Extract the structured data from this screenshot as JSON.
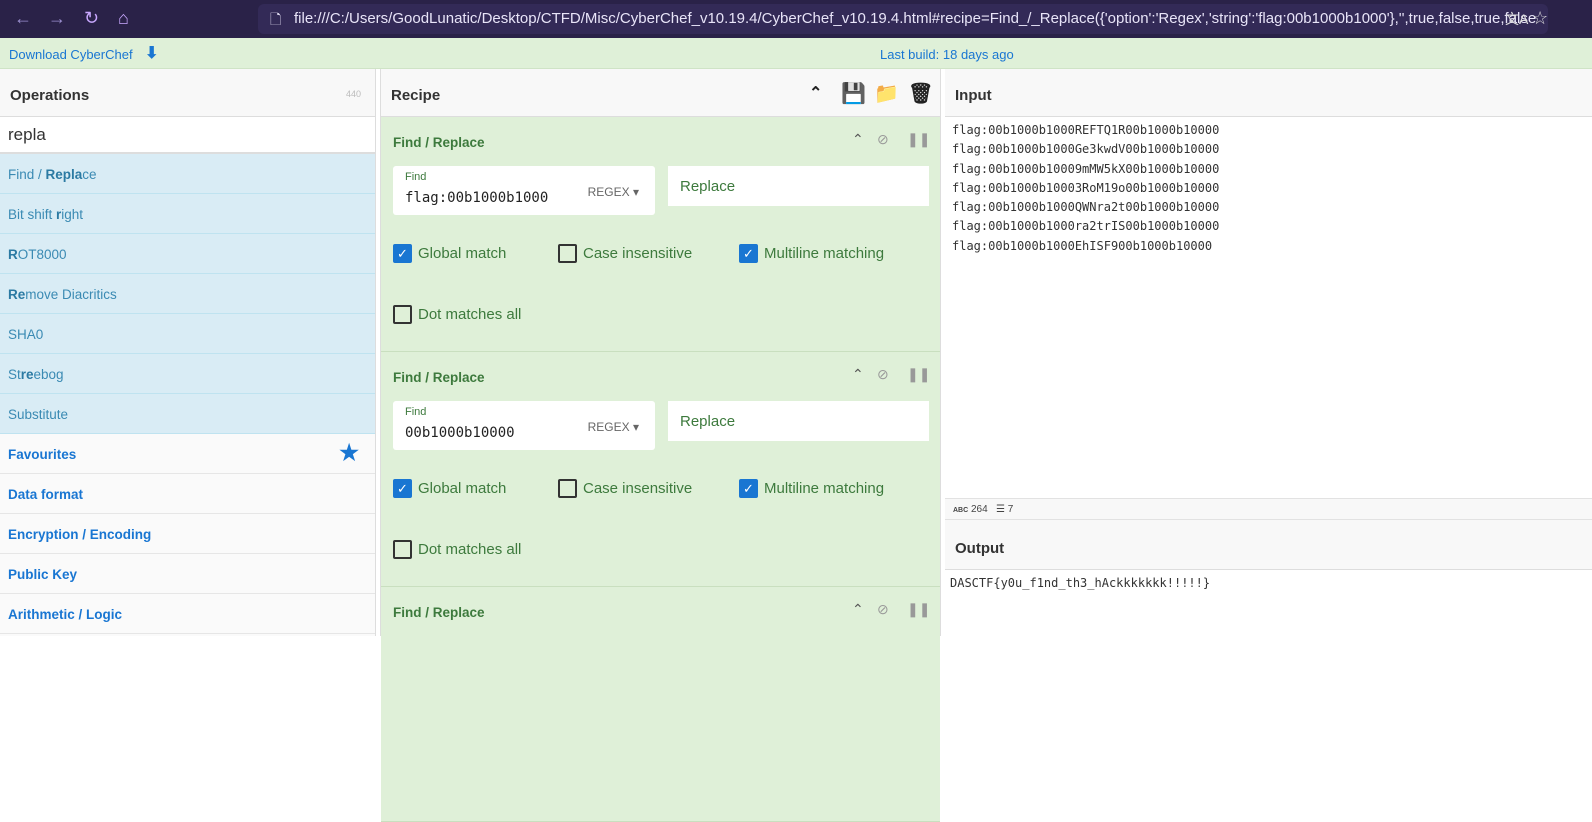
{
  "browser": {
    "url": "file:///C:/Users/GoodLunatic/Desktop/CTFD/Misc/CyberChef_v10.19.4/CyberChef_v10.19.4.html#recipe=Find_/_Replace({'option':'Regex','string':'flag:00b1000b1000'},'',true,false,true,false"
  },
  "banner": {
    "download": "Download CyberChef",
    "build": "Last build: 18 days ago"
  },
  "operations": {
    "title": "Operations",
    "count": "440",
    "search": "repla",
    "results": [
      {
        "pre": "Find / ",
        "bold": "Repla",
        "post": "ce"
      },
      {
        "pre": "Bit shift ",
        "bold": "r",
        "post": "ight"
      },
      {
        "pre": "",
        "bold": "R",
        "post": "OT8000"
      },
      {
        "pre": "",
        "bold": "Re",
        "post": "move Diacritics"
      },
      {
        "pre": "SHA0",
        "bold": "",
        "post": ""
      },
      {
        "pre": "St",
        "bold": "re",
        "post": "ebog"
      },
      {
        "pre": "Substitute",
        "bold": "",
        "post": ""
      }
    ],
    "categories": [
      "Favourites",
      "Data format",
      "Encryption / Encoding",
      "Public Key",
      "Arithmetic / Logic"
    ]
  },
  "recipe": {
    "title": "Recipe",
    "steps": [
      {
        "name": "Find / Replace",
        "find_label": "Find",
        "find": "flag:00b1000b1000",
        "mode": "REGEX",
        "replace_placeholder": "Replace",
        "global": "Global match",
        "case": "Case insensitive",
        "multiline": "Multiline matching",
        "dotall": "Dot matches all",
        "checked": {
          "global": true,
          "case": false,
          "multiline": true,
          "dotall": false
        }
      },
      {
        "name": "Find / Replace",
        "find_label": "Find",
        "find": "00b1000b10000",
        "mode": "REGEX",
        "replace_placeholder": "Replace",
        "global": "Global match",
        "case": "Case insensitive",
        "multiline": "Multiline matching",
        "dotall": "Dot matches all",
        "checked": {
          "global": true,
          "case": false,
          "multiline": true,
          "dotall": false
        }
      },
      {
        "name": "Find / Replace"
      }
    ]
  },
  "input": {
    "title": "Input",
    "text": "flag:00b1000b1000REFTQ1R00b1000b10000\nflag:00b1000b1000Ge3kwdV00b1000b10000\nflag:00b1000b10009mMW5kX00b1000b10000\nflag:00b1000b10003RoM19o00b1000b10000\nflag:00b1000b1000QWNra2t00b1000b10000\nflag:00b1000b1000ra2trIS00b1000b10000\nflag:00b1000b1000EhISF900b1000b10000",
    "chars": "264",
    "lines": "7"
  },
  "output": {
    "title": "Output",
    "text": "DASCTF{y0u_f1nd_th3_hAckkkkkkk!!!!!}"
  }
}
